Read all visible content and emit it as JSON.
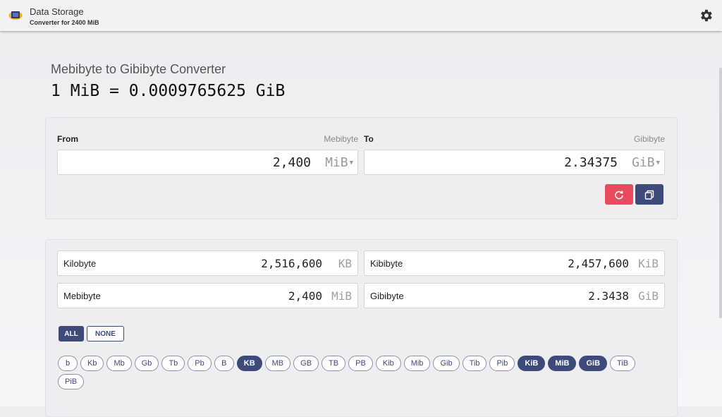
{
  "app": {
    "title": "Data Storage",
    "subtitle": "Converter for 2400 MiB",
    "logo_icon": "storage-drive-icon",
    "settings_icon": "gear-icon"
  },
  "converter": {
    "heading": "Mebibyte to Gibibyte Converter",
    "formula": "1 MiB = 0.0009765625 GiB",
    "from": {
      "label": "From",
      "hint": "Mebibyte",
      "value": "2,400",
      "unit": "MiB"
    },
    "to": {
      "label": "To",
      "hint": "Gibibyte",
      "value": "2.34375",
      "unit": "GiB"
    },
    "reset_icon": "refresh-icon",
    "copy_icon": "copy-icon",
    "colors": {
      "accent": "#3e4a7a",
      "reset": "#e84a5f"
    }
  },
  "results": [
    {
      "name": "Kilobyte",
      "value": "2,516,600",
      "unit": "KB"
    },
    {
      "name": "Kibibyte",
      "value": "2,457,600",
      "unit": "KiB"
    },
    {
      "name": "Mebibyte",
      "value": "2,400",
      "unit": "MiB"
    },
    {
      "name": "Gibibyte",
      "value": "2.3438",
      "unit": "GiB"
    }
  ],
  "selection": {
    "all_label": "ALL",
    "none_label": "NONE"
  },
  "units": [
    {
      "label": "b",
      "active": false
    },
    {
      "label": "Kb",
      "active": false
    },
    {
      "label": "Mb",
      "active": false
    },
    {
      "label": "Gb",
      "active": false
    },
    {
      "label": "Tb",
      "active": false
    },
    {
      "label": "Pb",
      "active": false
    },
    {
      "label": "B",
      "active": false
    },
    {
      "label": "KB",
      "active": true
    },
    {
      "label": "MB",
      "active": false
    },
    {
      "label": "GB",
      "active": false
    },
    {
      "label": "TB",
      "active": false
    },
    {
      "label": "PB",
      "active": false
    },
    {
      "label": "Kib",
      "active": false
    },
    {
      "label": "Mib",
      "active": false
    },
    {
      "label": "Gib",
      "active": false
    },
    {
      "label": "Tib",
      "active": false
    },
    {
      "label": "Pib",
      "active": false
    },
    {
      "label": "KiB",
      "active": true
    },
    {
      "label": "MiB",
      "active": true
    },
    {
      "label": "GiB",
      "active": true
    },
    {
      "label": "TiB",
      "active": false
    },
    {
      "label": "PiB",
      "active": false
    }
  ]
}
